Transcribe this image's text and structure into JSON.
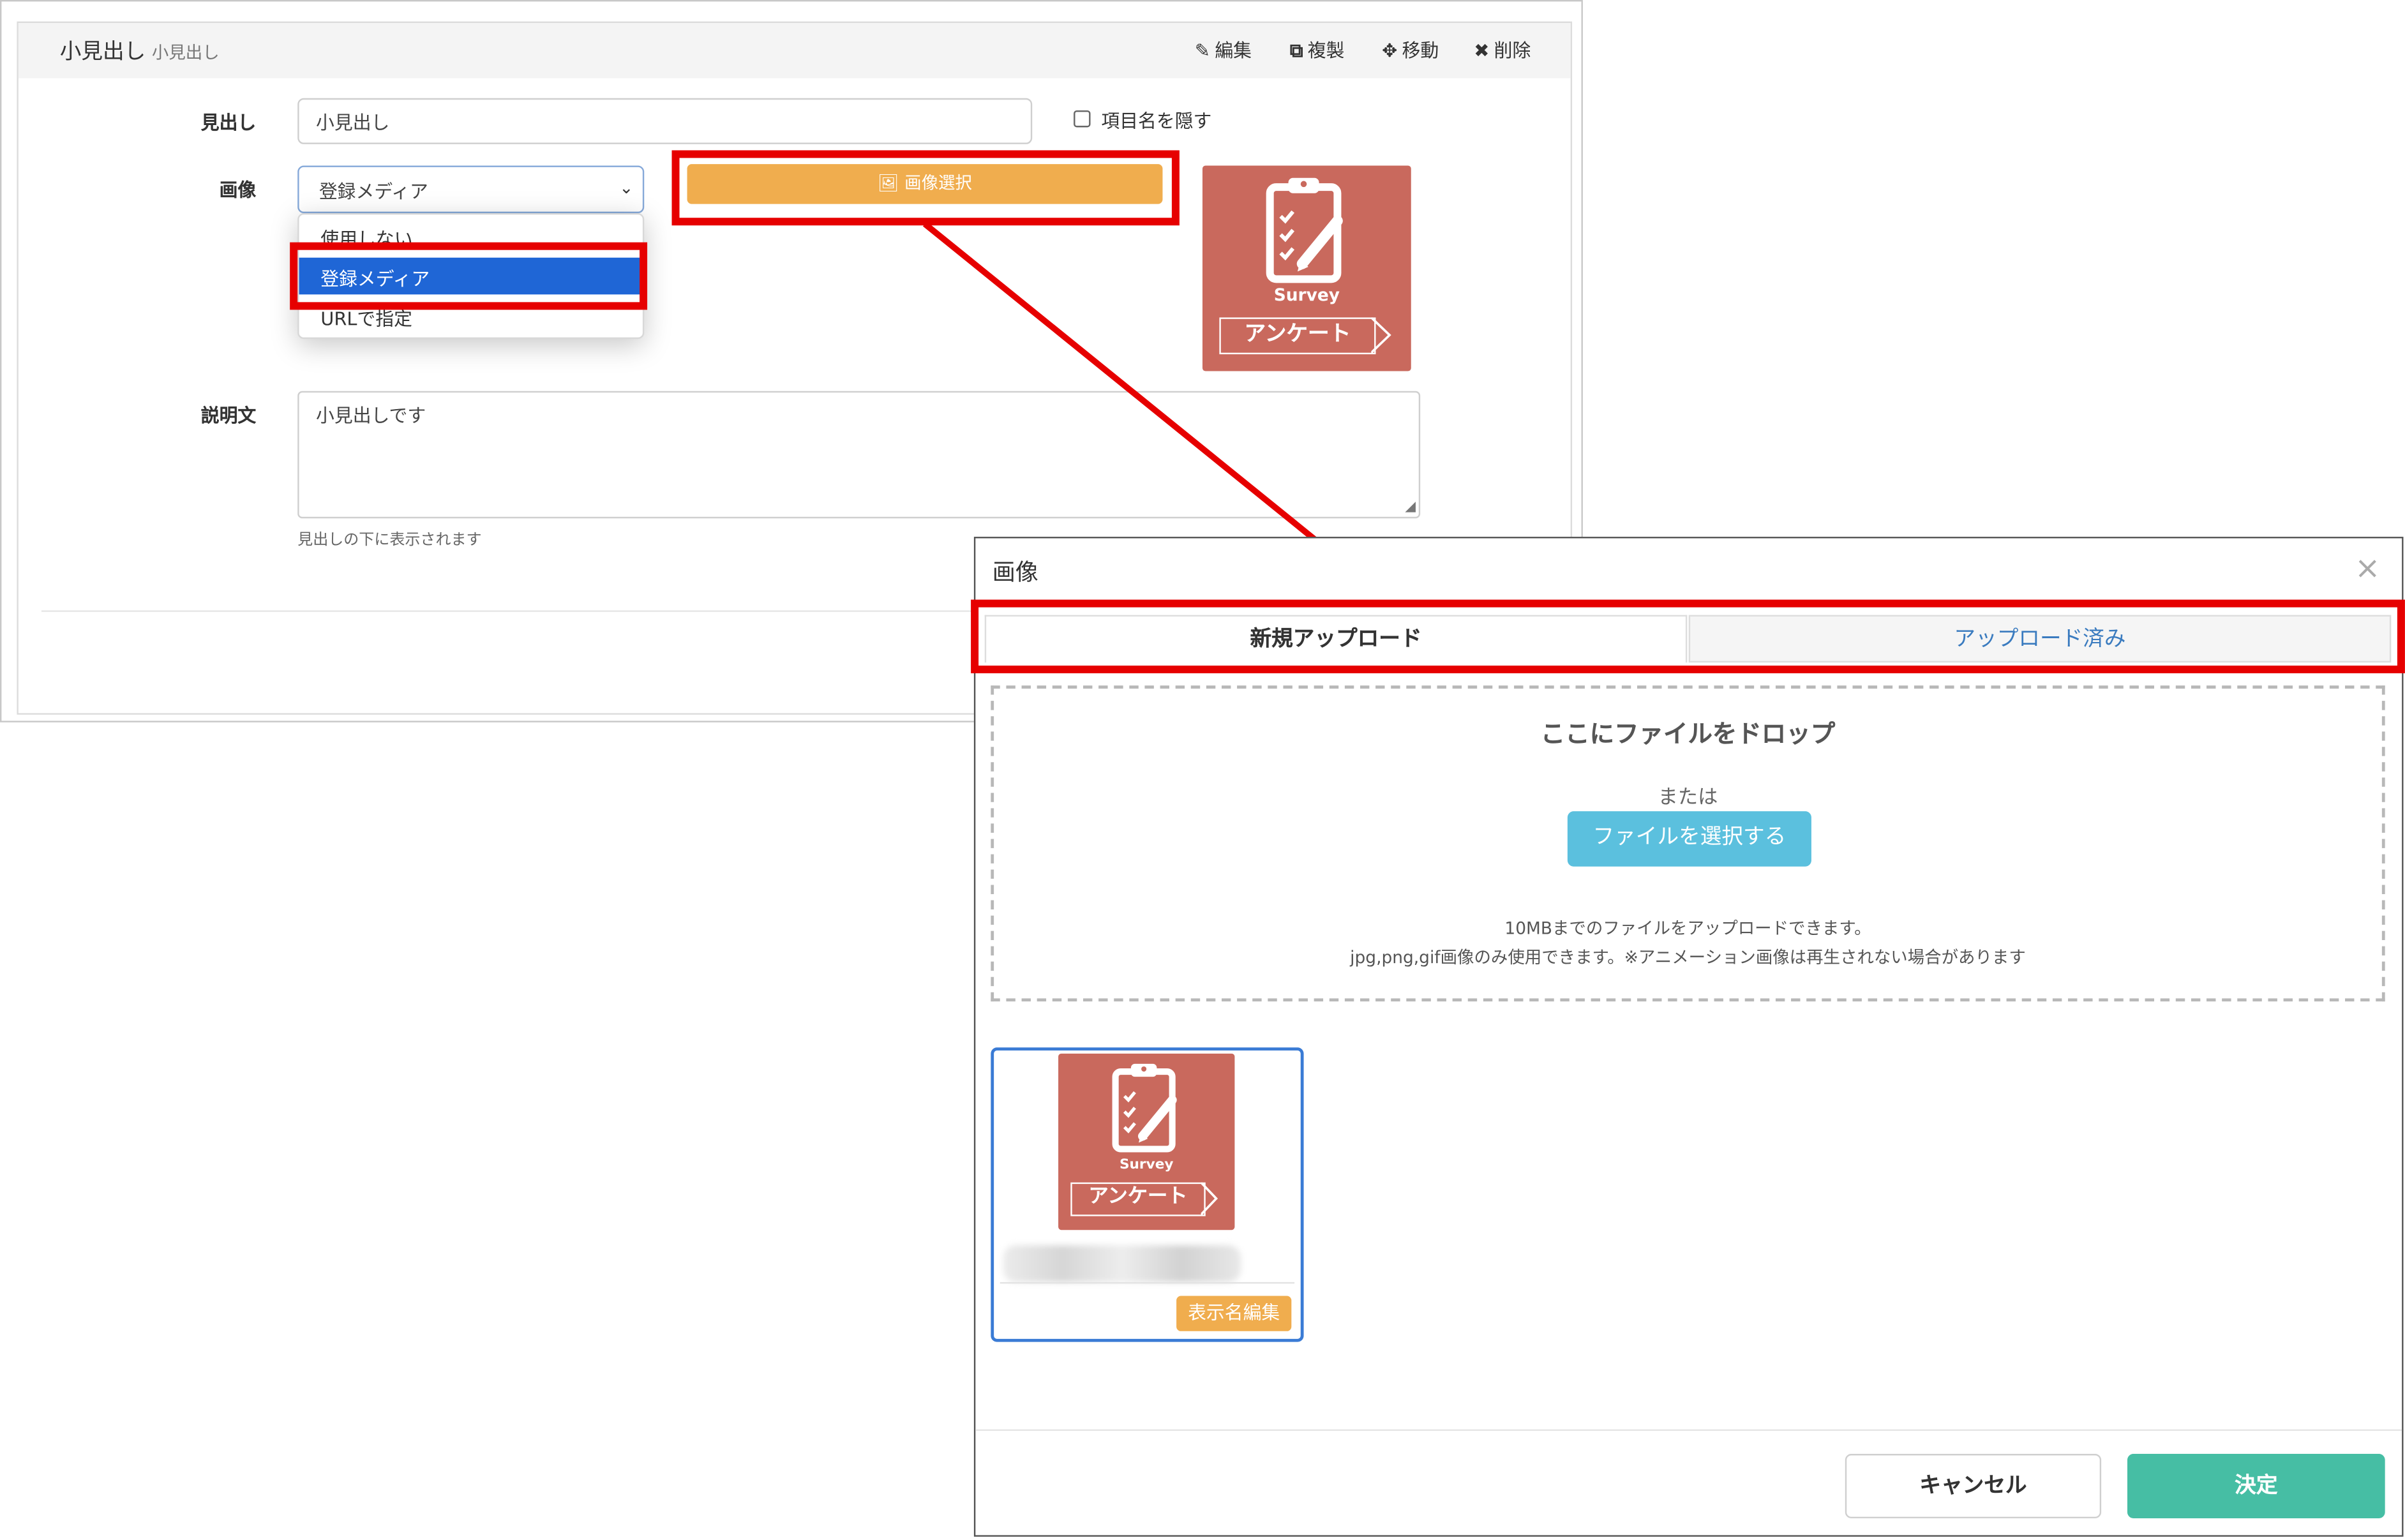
{
  "editor": {
    "title": "小見出し",
    "subtitle": "小見出し",
    "toolbar": {
      "edit": "編集",
      "copy": "複製",
      "move": "移動",
      "delete": "削除"
    },
    "heading_label": "見出し",
    "heading_value": "小見出し",
    "hide_label": "項目名を隠す",
    "image_label": "画像",
    "image_select_value": "登録メディア",
    "image_options": [
      "使用しない",
      "登録メディア",
      "URLで指定"
    ],
    "image_select_button": "画像選択",
    "description_label": "説明文",
    "description_value": "小見出しです",
    "description_help": "見出しの下に表示されます"
  },
  "survey_image": {
    "caption": "Survey",
    "tag": "アンケート"
  },
  "modal": {
    "title": "画像",
    "close": "×",
    "tabs": [
      "新規アップロード",
      "アップロード済み"
    ],
    "dropzone": {
      "title": "ここにファイルをドロップ",
      "or": "または",
      "button": "ファイルを選択する",
      "note1": "10MBまでのファイルをアップロードできます。",
      "note2": "jpg,png,gif画像のみ使用できます。※アニメーション画像は再生されない場合があります"
    },
    "rename_button": "表示名編集",
    "cancel": "キャンセル",
    "ok": "決定"
  },
  "colors": {
    "highlight": "#e60000",
    "orange_button": "#f0ad4e",
    "info_button": "#5bc0de",
    "ok_button": "#46bea4",
    "selected_option": "#1f66d6",
    "survey_bg": "#c9695d"
  }
}
